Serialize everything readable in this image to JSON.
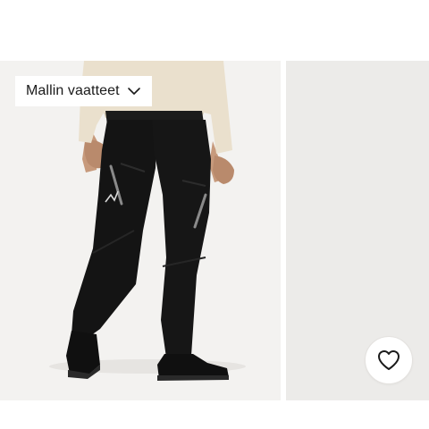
{
  "gallery": {
    "outfit_button": {
      "label": "Mallin vaatteet",
      "icon": "chevron-down-icon"
    },
    "wishlist_button": {
      "icon": "heart-icon"
    }
  },
  "colors": {
    "photo_background": "#f3f2f0",
    "next_photo_background": "#ecebe9",
    "pants": "#141414",
    "shirt": "#eae0cd",
    "text": "#1a1a1a"
  }
}
